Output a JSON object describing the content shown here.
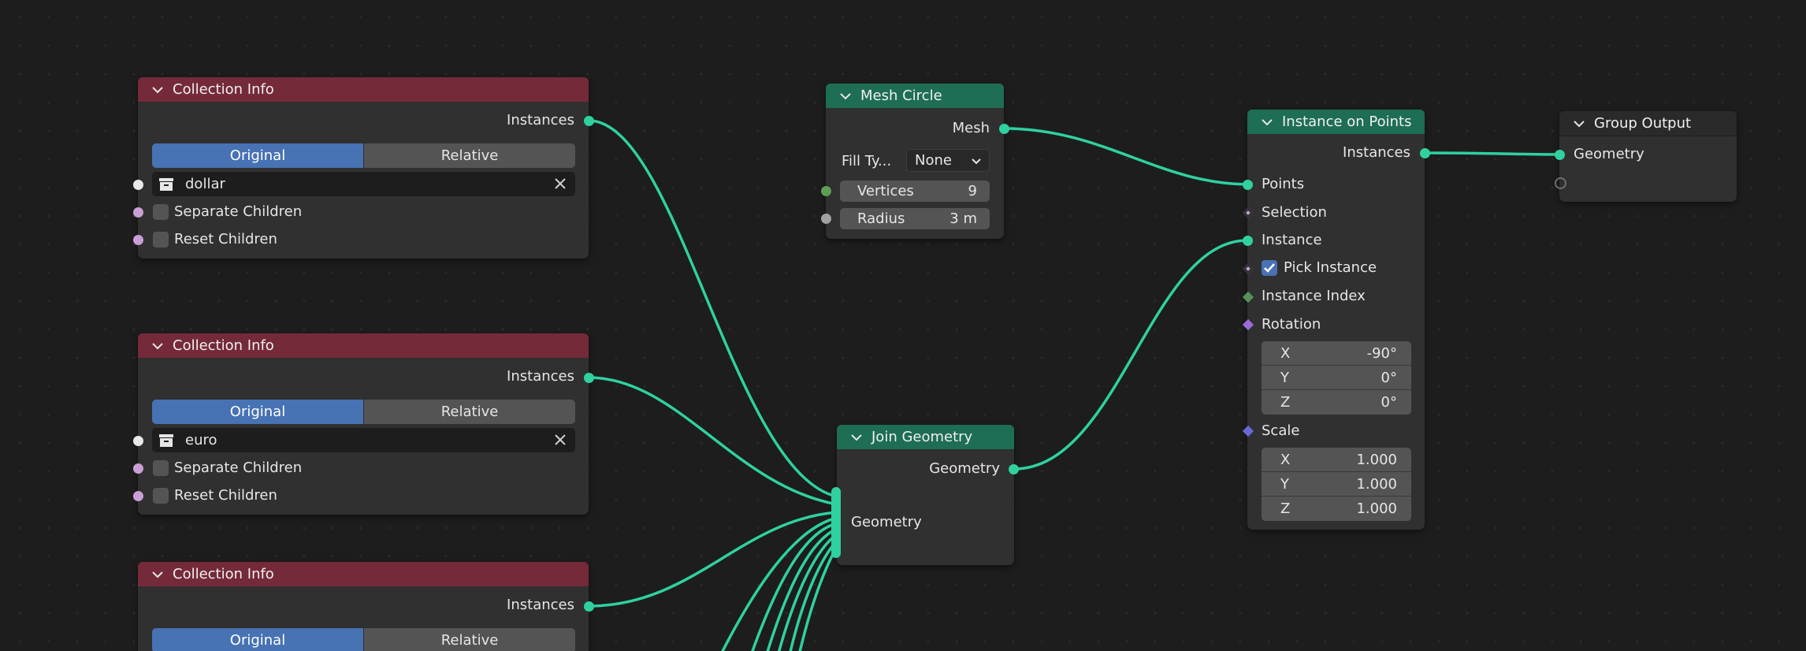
{
  "colors": {
    "background": "#1d1d1d",
    "node_body": "#303030",
    "header_input": "#742a39",
    "header_geometry": "#1e6d55",
    "header_output": "#2a2a2a",
    "wire": "#2fd1a0",
    "toggle_active": "#4772b3"
  },
  "nodes": {
    "collection_info_1": {
      "title": "Collection Info",
      "output": "Instances",
      "opt_original": "Original",
      "opt_relative": "Relative",
      "collection": "dollar",
      "separate_children": "Separate Children",
      "reset_children": "Reset Children"
    },
    "collection_info_2": {
      "title": "Collection Info",
      "output": "Instances",
      "opt_original": "Original",
      "opt_relative": "Relative",
      "collection": "euro",
      "separate_children": "Separate Children",
      "reset_children": "Reset Children"
    },
    "collection_info_3": {
      "title": "Collection Info",
      "output": "Instances",
      "opt_original": "Original",
      "opt_relative": "Relative"
    },
    "mesh_circle": {
      "title": "Mesh Circle",
      "output": "Mesh",
      "fill_type_label": "Fill Ty...",
      "fill_type_value": "None",
      "vertices_label": "Vertices",
      "vertices_value": "9",
      "radius_label": "Radius",
      "radius_value": "3 m"
    },
    "join_geometry": {
      "title": "Join Geometry",
      "output": "Geometry",
      "input": "Geometry"
    },
    "instance_on_points": {
      "title": "Instance on Points",
      "output": "Instances",
      "points": "Points",
      "selection": "Selection",
      "instance": "Instance",
      "pick_instance": "Pick Instance",
      "instance_index": "Instance Index",
      "rotation": "Rotation",
      "rotation_xyz": [
        {
          "axis": "X",
          "value": "-90°"
        },
        {
          "axis": "Y",
          "value": "0°"
        },
        {
          "axis": "Z",
          "value": "0°"
        }
      ],
      "scale": "Scale",
      "scale_xyz": [
        {
          "axis": "X",
          "value": "1.000"
        },
        {
          "axis": "Y",
          "value": "1.000"
        },
        {
          "axis": "Z",
          "value": "1.000"
        }
      ]
    },
    "group_output": {
      "title": "Group Output",
      "input": "Geometry"
    }
  }
}
